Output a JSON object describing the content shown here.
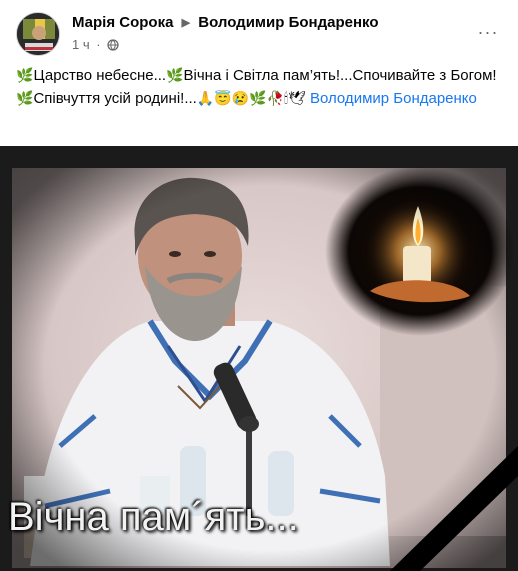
{
  "post": {
    "author": "Марія Сорока",
    "recipient": "Володимир Бондаренко",
    "time": "1 ч",
    "separator": "·",
    "text_parts": [
      "Царство небесне...",
      "Вічна і Світла пам’ять!...Спочивайте з Богом! ",
      "Співчуття усій родині!..."
    ],
    "tagged_person": "Володимир Бондаренко",
    "icons": [
      "leaf-emoji",
      "leaf-emoji",
      "leaf-emoji",
      "praying-hands-emoji",
      "angel-emoji",
      "sad-face-emoji",
      "leaf-emoji",
      "rose-emoji",
      "candle-emoji",
      "dove-emoji",
      "globe-icon",
      "more-options-icon",
      "arrow-right-icon"
    ]
  },
  "photo": {
    "caption": "Вічна пам´ять..."
  },
  "colors": {
    "link": "#1877f2",
    "secondary_text": "#65676b",
    "primary_text": "#050505"
  }
}
